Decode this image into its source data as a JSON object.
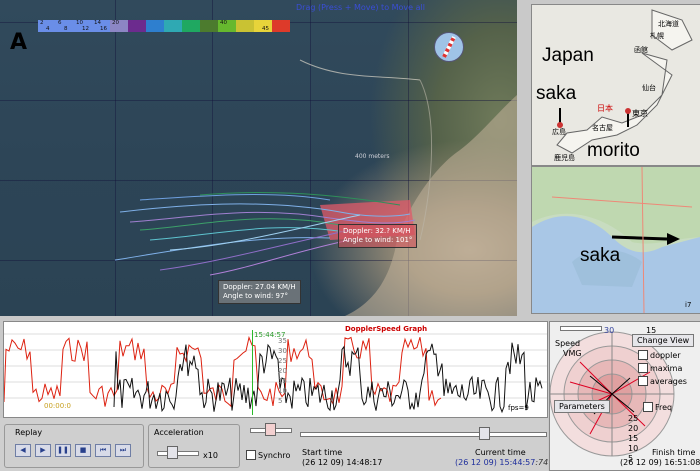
{
  "map": {
    "drag_hint": "Drag (Press + Move) to Move all",
    "north_symbol": "A",
    "scale_label": "400 meters",
    "colorbar": {
      "colors": [
        "#6a8ee8",
        "#6a8ee8",
        "#6a8ee8",
        "#6a8ee8",
        "#8c86c4",
        "#6c2b8e",
        "#2e7fcf",
        "#2fa9b3",
        "#1fa861",
        "#4c7b2e",
        "#66b82e",
        "#c9c233",
        "#e7d43a",
        "#dd3a2a"
      ],
      "top_labels": [
        "2",
        "6",
        "10",
        "14",
        "20",
        "",
        "",
        "",
        "",
        "",
        "40",
        "",
        "",
        ""
      ],
      "bottom_labels": [
        "4",
        "8",
        "12",
        "16",
        "",
        "",
        "",
        "",
        "",
        "",
        "",
        "",
        "45",
        ""
      ]
    },
    "track_info_1": {
      "doppler": "Doppler: 32.? KM/H",
      "angle": "Angle to wind: 101°"
    },
    "track_info_2": {
      "doppler": "Doppler: 27.04 KM/H",
      "angle": "Angle to wind: 97°"
    }
  },
  "japan_map": {
    "title": "Japan",
    "saka": "saka",
    "morito": "morito",
    "nihon": "日本",
    "tokyo": "東京",
    "sapporo": "札幌",
    "hakodate": "函館",
    "hokkaido": "北海道",
    "sendai": "仙台",
    "hiroshima": "広島",
    "nagoya": "名古屋",
    "kagoshima": "鹿児島"
  },
  "local_map": {
    "saka": "saka",
    "corner_label": "i7"
  },
  "graph": {
    "title": "DopplerSpeed Graph",
    "cursor_time": "15:44:57",
    "y_ticks": [
      "35",
      "30",
      "25",
      "20",
      "15",
      "10",
      "5"
    ],
    "start_time_label": "00:00:0",
    "fps": "fps=9"
  },
  "radar": {
    "change_view": "Change View",
    "speed_label": "Speed",
    "vmg_label": "VMG",
    "ticks": [
      "15",
      "30",
      "30",
      "10",
      "5"
    ],
    "checks": [
      {
        "label": "doppler",
        "checked": true
      },
      {
        "label": "maxima",
        "checked": true
      },
      {
        "label": "averages",
        "checked": true
      },
      {
        "label": "Freq",
        "checked": false
      }
    ],
    "parameters": "Parameters",
    "scale_labels": [
      "25",
      "20",
      "15",
      "10",
      "5"
    ]
  },
  "bottom": {
    "replay_label": "Replay",
    "acceleration_label": "Acceleration",
    "accel_value": "x10",
    "synchro_label": "Synchro",
    "start_time_label": "Start time",
    "start_time_value": "(26 12 09) 14:48:17",
    "current_time_label": "Current time",
    "current_time_value": "(26 12 09) 15:44:57",
    "current_time_suffix": ":74",
    "finish_time_label": "Finish time",
    "finish_time_value": "(26 12 09) 16:51:08"
  }
}
